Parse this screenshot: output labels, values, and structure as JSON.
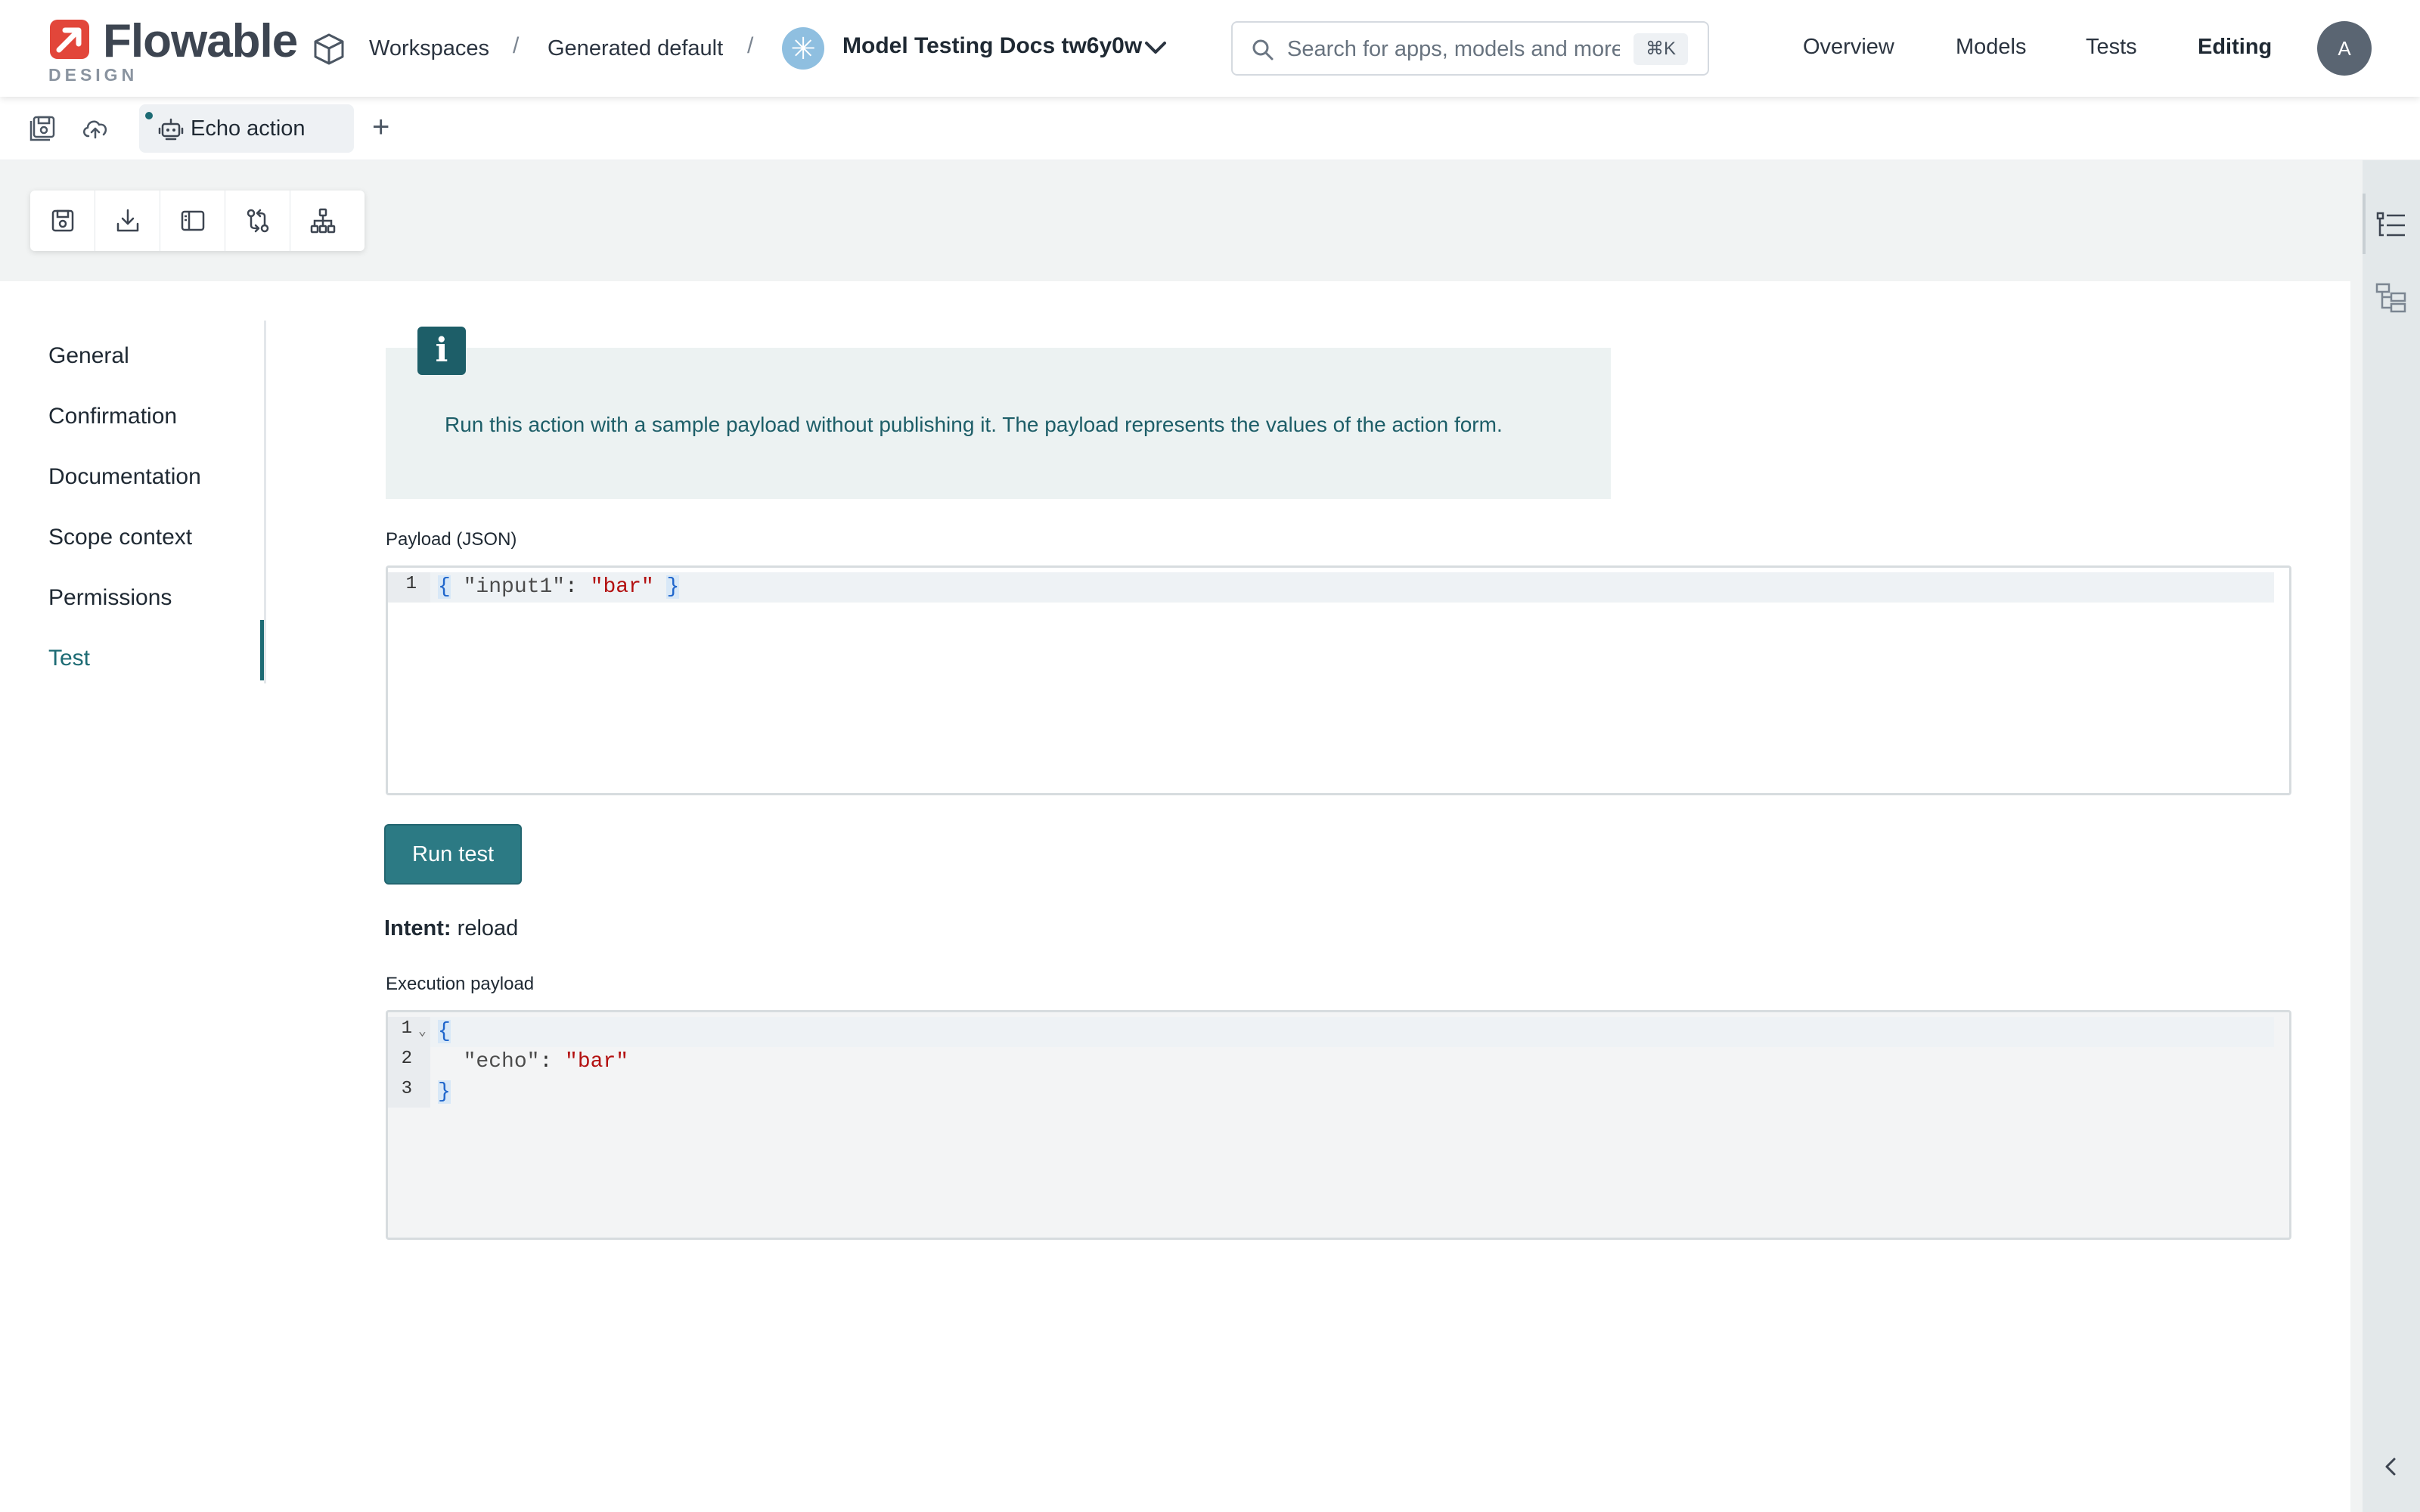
{
  "header": {
    "logo_text": "Flowable",
    "logo_sub": "DESIGN",
    "breadcrumb": [
      "Workspaces",
      "Generated default"
    ],
    "app_name": "Model Testing Docs tw6y0w",
    "search_placeholder": "Search for apps, models and more",
    "search_shortcut": "⌘K",
    "nav": [
      "Overview",
      "Models",
      "Tests",
      "Editing"
    ],
    "active_nav": "Editing",
    "avatar_initial": "A"
  },
  "tabs": {
    "open": [
      {
        "label": "Echo action",
        "icon": "robot-icon",
        "unsaved": true
      }
    ],
    "add_icon": "plus-icon"
  },
  "toolbar": {
    "tools": [
      "save-icon",
      "download-icon",
      "panel-icon",
      "compare-icon",
      "hierarchy-icon"
    ]
  },
  "menu": {
    "items": [
      "General",
      "Confirmation",
      "Documentation",
      "Scope context",
      "Permissions",
      "Test"
    ],
    "active": "Test"
  },
  "test": {
    "info_text": "Run this action with a sample payload without publishing it. The payload represents the values of the action form.",
    "payload_label": "Payload (JSON)",
    "payload_lines": [
      "{ \"input1\": \"bar\" }"
    ],
    "run_button": "Run test",
    "intent_label": "Intent:",
    "intent_value": "reload",
    "execution_label": "Execution payload",
    "execution_lines": [
      "{",
      "  \"echo\": \"bar\"",
      "}"
    ]
  },
  "colors": {
    "accent": "#1d6b74",
    "button": "#2c7a84",
    "info_bg": "#ecf2f2",
    "logo_red": "#e2463a"
  }
}
